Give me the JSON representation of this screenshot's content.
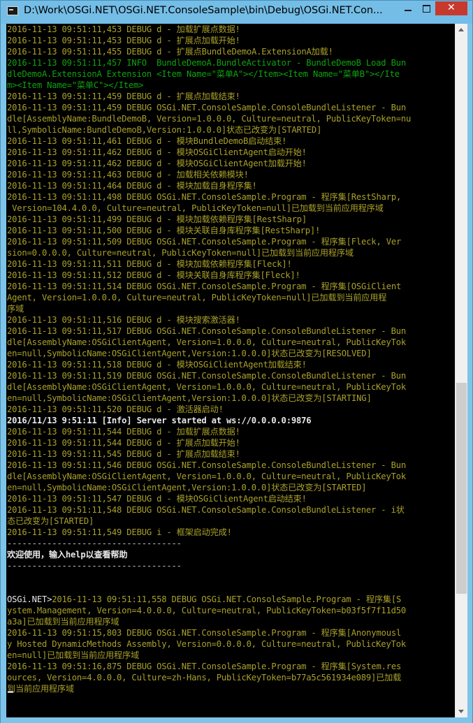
{
  "window": {
    "title": "D:\\Work\\OSGi.NET\\OSGi.NET.ConsoleSample\\bin\\Debug\\OSGi.NET.Con..."
  },
  "colors": {
    "console_background": "#000000",
    "debug_text": "#a9a02a",
    "info_text": "#0fa30f",
    "bright_text": "#e8e8e8"
  },
  "console": {
    "lines": [
      {
        "text": "2016-11-13 09:51:11,453 DEBUG d - 加载扩展点数据!",
        "style": "debug"
      },
      {
        "text": "2016-11-13 09:51:11,453 DEBUG d - 扩展点加载开始!",
        "style": "debug"
      },
      {
        "text": "2016-11-13 09:51:11,455 DEBUG d - 扩展点BundleDemoA.ExtensionA加载!",
        "style": "debug"
      },
      {
        "text": "2016-11-13 09:51:11,457 INFO  BundleDemoA.BundleActivator - BundleDemoB Load Bun",
        "style": "info"
      },
      {
        "text": "dleDemoA.ExtensionA Extension <Item Name=\"菜单A\"></Item><Item Name=\"菜单B\"></Ite",
        "style": "info"
      },
      {
        "text": "m><Item Name=\"菜单C\"></Item>",
        "style": "info"
      },
      {
        "text": "2016-11-13 09:51:11,459 DEBUG d - 扩展点加载结束!",
        "style": "debug"
      },
      {
        "text": "2016-11-13 09:51:11,459 DEBUG OSGi.NET.ConsoleSample.ConsoleBundleListener - Bun",
        "style": "debug"
      },
      {
        "text": "dle[AssemblyName:BundleDemoB, Version=1.0.0.0, Culture=neutral, PublicKeyToken=nu",
        "style": "debug"
      },
      {
        "text": "ll,SymbolicName:BundleDemoB,Version:1.0.0.0]状态已改变为[STARTED]",
        "style": "debug"
      },
      {
        "text": "2016-11-13 09:51:11,461 DEBUG d - 模块BundleDemoB启动结束!",
        "style": "debug"
      },
      {
        "text": "2016-11-13 09:51:11,462 DEBUG d - 模块OSGiClientAgent启动开始!",
        "style": "debug"
      },
      {
        "text": "2016-11-13 09:51:11,462 DEBUG d - 模块OSGiClientAgent加载开始!",
        "style": "debug"
      },
      {
        "text": "2016-11-13 09:51:11,463 DEBUG d - 加载相关依赖模块!",
        "style": "debug"
      },
      {
        "text": "2016-11-13 09:51:11,464 DEBUG d - 模块加载自身程序集!",
        "style": "debug"
      },
      {
        "text": "2016-11-13 09:51:11,498 DEBUG OSGi.NET.ConsoleSample.Program - 程序集[RestSharp,",
        "style": "debug"
      },
      {
        "text": " Version=104.4.0.0, Culture=neutral, PublicKeyToken=null]已加载到当前应用程序域",
        "style": "debug"
      },
      {
        "text": "2016-11-13 09:51:11,499 DEBUG d - 模块加载依赖程序集[RestSharp]",
        "style": "debug"
      },
      {
        "text": "2016-11-13 09:51:11,500 DEBUG d - 模块关联自身库程序集[RestSharp]!",
        "style": "debug"
      },
      {
        "text": "2016-11-13 09:51:11,509 DEBUG OSGi.NET.ConsoleSample.Program - 程序集[Fleck, Ver",
        "style": "debug"
      },
      {
        "text": "sion=0.0.0.0, Culture=neutral, PublicKeyToken=null]已加载到当前应用程序域",
        "style": "debug"
      },
      {
        "text": "2016-11-13 09:51:11,511 DEBUG d - 模块加载依赖程序集[Fleck]!",
        "style": "debug"
      },
      {
        "text": "2016-11-13 09:51:11,512 DEBUG d - 模块关联自身库程序集[Fleck]!",
        "style": "debug"
      },
      {
        "text": "2016-11-13 09:51:11,514 DEBUG OSGi.NET.ConsoleSample.Program - 程序集[OSGiClient",
        "style": "debug"
      },
      {
        "text": "Agent, Version=1.0.0.0, Culture=neutral, PublicKeyToken=null]已加载到当前应用程",
        "style": "debug"
      },
      {
        "text": "序域",
        "style": "debug"
      },
      {
        "text": "2016-11-13 09:51:11,516 DEBUG d - 模块搜索激活器!",
        "style": "debug"
      },
      {
        "text": "2016-11-13 09:51:11,517 DEBUG OSGi.NET.ConsoleSample.ConsoleBundleListener - Bun",
        "style": "debug"
      },
      {
        "text": "dle[AssemblyName:OSGiClientAgent, Version=1.0.0.0, Culture=neutral, PublicKeyTok",
        "style": "debug"
      },
      {
        "text": "en=null,SymbolicName:OSGiClientAgent,Version:1.0.0.0]状态已改变为[RESOLVED]",
        "style": "debug"
      },
      {
        "text": "2016-11-13 09:51:11,518 DEBUG d - 模块OSGiClientAgent加载结束!",
        "style": "debug"
      },
      {
        "text": "2016-11-13 09:51:11,519 DEBUG OSGi.NET.ConsoleSample.ConsoleBundleListener - Bun",
        "style": "debug"
      },
      {
        "text": "dle[AssemblyName:OSGiClientAgent, Version=1.0.0.0, Culture=neutral, PublicKeyTok",
        "style": "debug"
      },
      {
        "text": "en=null,SymbolicName:OSGiClientAgent,Version:1.0.0.0]状态已改变为[STARTING]",
        "style": "debug"
      },
      {
        "text": "2016-11-13 09:51:11,520 DEBUG d - 激活器启动!",
        "style": "debug"
      },
      {
        "text": "2016/11/13 9:51:11 [Info] Server started at ws://0.0.0.0:9876",
        "style": "white"
      },
      {
        "text": "2016-11-13 09:51:11,544 DEBUG d - 加载扩展点数据!",
        "style": "debug"
      },
      {
        "text": "2016-11-13 09:51:11,544 DEBUG d - 扩展点加载开始!",
        "style": "debug"
      },
      {
        "text": "2016-11-13 09:51:11,545 DEBUG d - 扩展点加载结束!",
        "style": "debug"
      },
      {
        "text": "2016-11-13 09:51:11,546 DEBUG OSGi.NET.ConsoleSample.ConsoleBundleListener - Bun",
        "style": "debug"
      },
      {
        "text": "dle[AssemblyName:OSGiClientAgent, Version=1.0.0.0, Culture=neutral, PublicKeyTok",
        "style": "debug"
      },
      {
        "text": "en=null,SymbolicName:OSGiClientAgent,Version:1.0.0.0]状态已改变为[STARTED]",
        "style": "debug"
      },
      {
        "text": "2016-11-13 09:51:11,547 DEBUG d - 模块OSGiClientAgent启动结束!",
        "style": "debug"
      },
      {
        "text": "2016-11-13 09:51:11,548 DEBUG OSGi.NET.ConsoleSample.ConsoleBundleListener - i状",
        "style": "debug"
      },
      {
        "text": "态已改变为[STARTED]",
        "style": "debug"
      },
      {
        "text": "2016-11-13 09:51:11,549 DEBUG i - 框架启动完成!",
        "style": "debug"
      },
      {
        "text": "-----------------------------------",
        "style": "plain"
      },
      {
        "text": "欢迎使用，输入help以查看帮助",
        "style": "white"
      },
      {
        "text": "-----------------------------------",
        "style": "plain"
      },
      {
        "text": "",
        "style": "plain"
      },
      {
        "text": "",
        "style": "plain"
      },
      {
        "text": "OSGi.NET>",
        "style": "prompt",
        "after": "2016-11-13 09:51:11,558 DEBUG OSGi.NET.ConsoleSample.Program - 程序集[S"
      },
      {
        "text": "ystem.Management, Version=4.0.0.0, Culture=neutral, PublicKeyToken=b03f5f7f11d50",
        "style": "debug"
      },
      {
        "text": "a3a]已加载到当前应用程序域",
        "style": "debug"
      },
      {
        "text": "2016-11-13 09:51:15,803 DEBUG OSGi.NET.ConsoleSample.Program - 程序集[Anonymousl",
        "style": "debug"
      },
      {
        "text": "y Hosted DynamicMethods Assembly, Version=0.0.0.0, Culture=neutral, PublicKeyTok",
        "style": "debug"
      },
      {
        "text": "en=null]已加载到当前应用程序域",
        "style": "debug"
      },
      {
        "text": "2016-11-13 09:51:16,875 DEBUG OSGi.NET.ConsoleSample.Program - 程序集[System.res",
        "style": "debug"
      },
      {
        "text": "ources, Version=4.0.0.0, Culture=zh-Hans, PublicKeyToken=b77a5c561934e089]已加载",
        "style": "debug"
      },
      {
        "text": "到当前应用程序域",
        "style": "debug"
      }
    ]
  }
}
